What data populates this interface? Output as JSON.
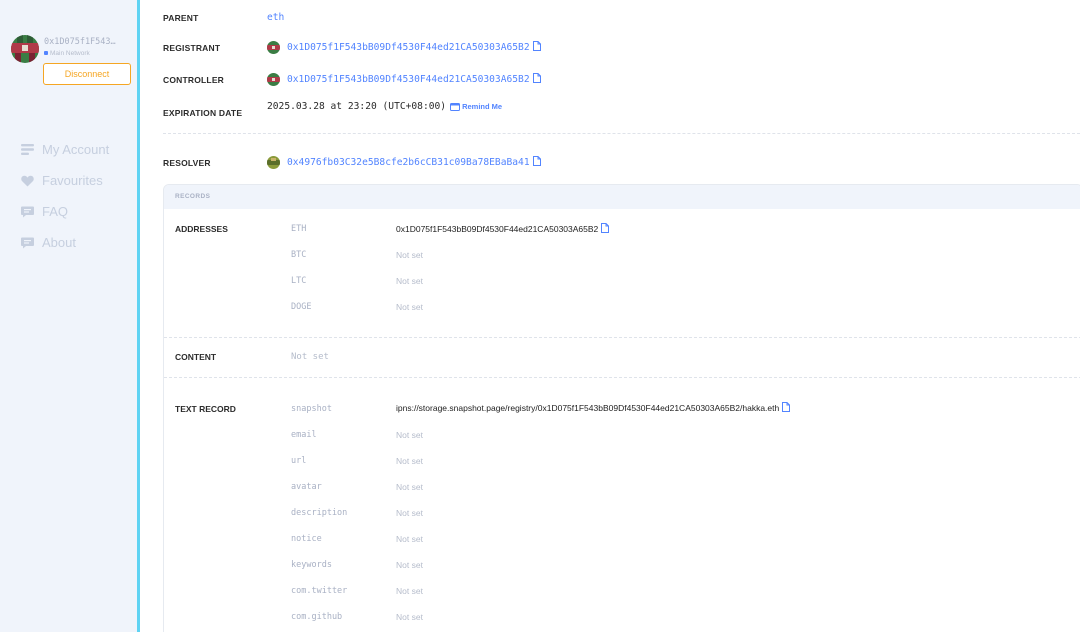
{
  "sidebar": {
    "account": {
      "address": "0x1D075f1F543…",
      "network": "Main Network",
      "disconnect_label": "Disconnect"
    },
    "nav": [
      {
        "label": "My Account",
        "icon": "list-icon"
      },
      {
        "label": "Favourites",
        "icon": "heart-icon"
      },
      {
        "label": "FAQ",
        "icon": "chat-icon"
      },
      {
        "label": "About",
        "icon": "chat-icon"
      }
    ]
  },
  "details": {
    "parent": {
      "label": "PARENT",
      "value": "eth"
    },
    "registrant": {
      "label": "REGISTRANT",
      "value": "0x1D075f1F543bB09Df4530F44ed21CA50303A65B2"
    },
    "controller": {
      "label": "CONTROLLER",
      "value": "0x1D075f1F543bB09Df4530F44ed21CA50303A65B2"
    },
    "expiration": {
      "label": "EXPIRATION DATE",
      "value": "2025.03.28 at 23:20 (UTC+08:00)",
      "remind_label": "Remind Me"
    },
    "resolver": {
      "label": "RESOLVER",
      "value": "0x4976fb03C32e5B8cfe2b6cCB31c09Ba78EBaBa41"
    }
  },
  "records": {
    "header": "RECORDS",
    "addresses": {
      "label": "ADDRESSES",
      "rows": [
        {
          "key": "ETH",
          "value": "0x1D075f1F543bB09Df4530F44ed21CA50303A65B2",
          "set": true
        },
        {
          "key": "BTC",
          "value": "Not set",
          "set": false
        },
        {
          "key": "LTC",
          "value": "Not set",
          "set": false
        },
        {
          "key": "DOGE",
          "value": "Not set",
          "set": false
        }
      ]
    },
    "content": {
      "label": "CONTENT",
      "value": "Not set"
    },
    "text": {
      "label": "TEXT RECORD",
      "rows": [
        {
          "key": "snapshot",
          "value": "ipns://storage.snapshot.page/registry/0x1D075f1F543bB09Df4530F44ed21CA50303A65B2/hakka.eth",
          "set": true
        },
        {
          "key": "email",
          "value": "Not set",
          "set": false
        },
        {
          "key": "url",
          "value": "Not set",
          "set": false
        },
        {
          "key": "avatar",
          "value": "Not set",
          "set": false
        },
        {
          "key": "description",
          "value": "Not set",
          "set": false
        },
        {
          "key": "notice",
          "value": "Not set",
          "set": false
        },
        {
          "key": "keywords",
          "value": "Not set",
          "set": false
        },
        {
          "key": "com.twitter",
          "value": "Not set",
          "set": false
        },
        {
          "key": "com.github",
          "value": "Not set",
          "set": false
        }
      ]
    }
  },
  "colors": {
    "accent": "#5284ff",
    "sidebar_bg": "#f0f4fb",
    "sidebar_border": "#5fd3f3",
    "disconnect": "#f5a623"
  }
}
